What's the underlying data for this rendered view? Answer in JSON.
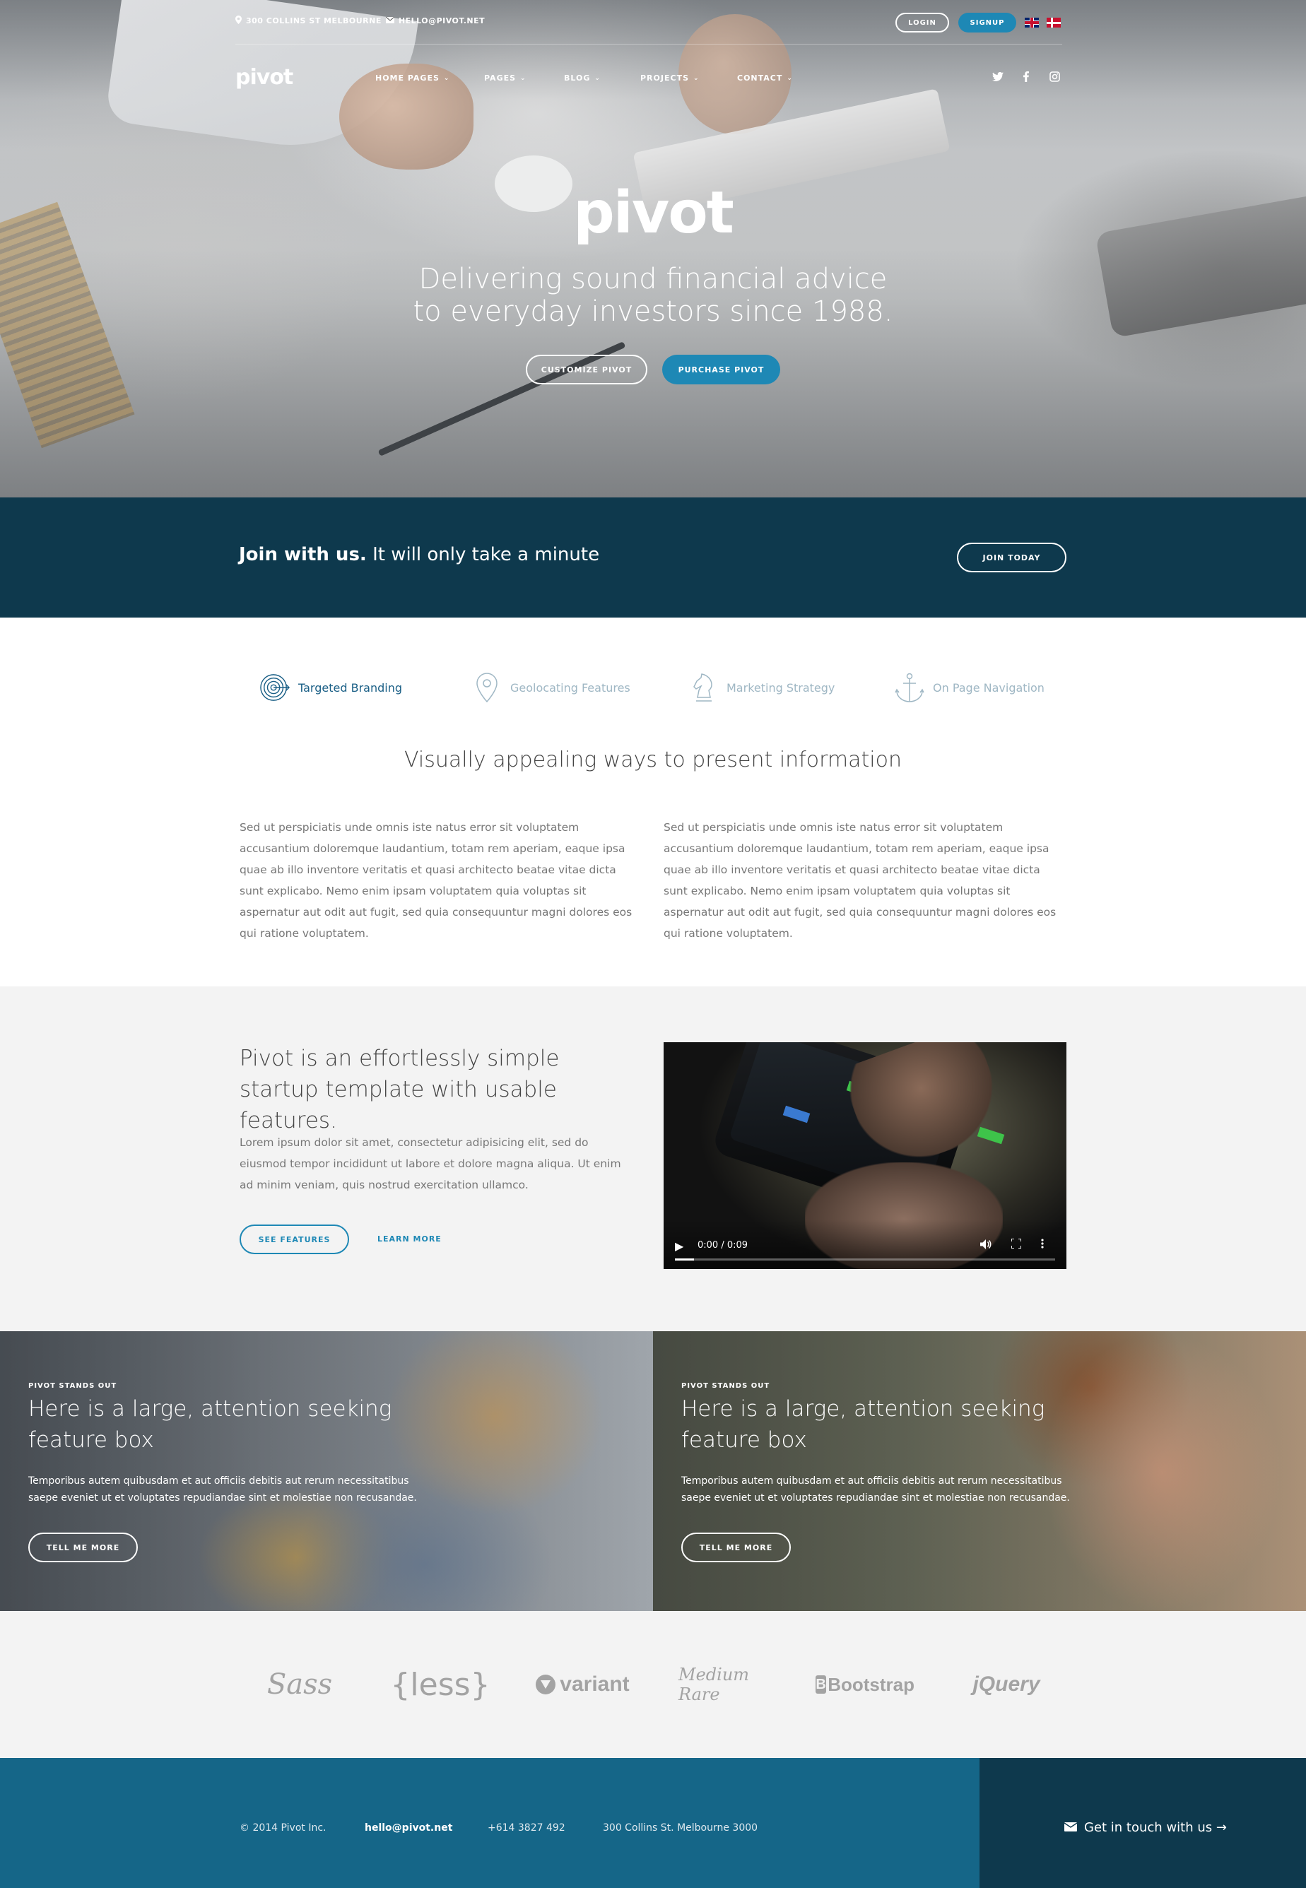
{
  "topbar": {
    "address": "300 COLLINS ST MELBOURNE",
    "email": "HELLO@PIVOT.NET",
    "login_label": "LOGIN",
    "signup_label": "SIGNUP"
  },
  "nav": {
    "logo": "pivot",
    "items": [
      {
        "label": "HOME PAGES"
      },
      {
        "label": "PAGES"
      },
      {
        "label": "BLOG"
      },
      {
        "label": "PROJECTS"
      },
      {
        "label": "CONTACT"
      }
    ],
    "social_icons": [
      "twitter-icon",
      "facebook-icon",
      "instagram-icon"
    ]
  },
  "hero": {
    "title": "pivot",
    "subtitle_line1": "Delivering sound financial advice",
    "subtitle_line2": "to everyday investors since 1988.",
    "customize_label": "CUSTOMIZE PIVOT",
    "purchase_label": "PURCHASE PIVOT"
  },
  "join": {
    "bold": "Join with us.",
    "rest": "It will only take a minute",
    "button_label": "JOIN TODAY"
  },
  "features": {
    "tabs": [
      {
        "label": "Targeted Branding",
        "icon": "target-icon",
        "active": true
      },
      {
        "label": "Geolocating Features",
        "icon": "map-pin-icon",
        "active": false
      },
      {
        "label": "Marketing Strategy",
        "icon": "chess-knight-icon",
        "active": false
      },
      {
        "label": "On Page Navigation",
        "icon": "anchor-icon",
        "active": false
      }
    ],
    "title": "Visually appealing ways to present information",
    "paragraph_left": "Sed ut perspiciatis unde omnis iste natus error sit voluptatem accusantium doloremque laudantium, totam rem aperiam, eaque ipsa quae ab illo inventore veritatis et quasi architecto beatae vitae dicta sunt explicabo. Nemo enim ipsam voluptatem quia voluptas sit aspernatur aut odit aut fugit, sed quia consequuntur magni dolores eos qui ratione voluptatem.",
    "paragraph_right": "Sed ut perspiciatis unde omnis iste natus error sit voluptatem accusantium doloremque laudantium, totam rem aperiam, eaque ipsa quae ab illo inventore veritatis et quasi architecto beatae vitae dicta sunt explicabo. Nemo enim ipsam voluptatem quia voluptas sit aspernatur aut odit aut fugit, sed quia consequuntur magni dolores eos qui ratione voluptatem."
  },
  "startup": {
    "title": "Pivot is an effortlessly simple startup template with usable features.",
    "paragraph": "Lorem ipsum dolor sit amet, consectetur adipisicing elit, sed do eiusmod tempor incididunt ut labore et dolore magna aliqua. Ut enim ad minim veniam, quis nostrud exercitation ullamco.",
    "see_features_label": "SEE FEATURES",
    "learn_more_label": "LEARN MORE",
    "video": {
      "time": "0:00 / 0:09",
      "progress": 0.05
    }
  },
  "feature_boxes": [
    {
      "kicker": "PIVOT STANDS OUT",
      "title": "Here is a large, attention seeking feature box",
      "paragraph": "Temporibus autem quibusdam et aut officiis debitis aut rerum necessitatibus saepe eveniet ut et voluptates repudiandae sint et molestiae non recusandae.",
      "button_label": "TELL ME MORE"
    },
    {
      "kicker": "PIVOT STANDS OUT",
      "title": "Here is a large, attention seeking feature box",
      "paragraph": "Temporibus autem quibusdam et aut officiis debitis aut rerum necessitatibus saepe eveniet ut et voluptates repudiandae sint et molestiae non recusandae.",
      "button_label": "TELL ME MORE"
    }
  ],
  "logos": {
    "sass": "Sass",
    "less": "{less}",
    "variant": "variant",
    "medium_rare": "Medium Rare",
    "bootstrap": "Bootstrap",
    "bootstrap_mark": "B",
    "jquery": "jQuery"
  },
  "footer": {
    "copyright": "© 2014 Pivot Inc.",
    "email": "hello@pivot.net",
    "phone": "+614 3827 492",
    "address": "300 Collins St. Melbourne 3000",
    "cta": "Get in touch with us →"
  },
  "colors": {
    "accent": "#1e88b5",
    "dark_band": "#0e394d",
    "footer": "#156688",
    "grey_bg": "#f3f3f3"
  }
}
